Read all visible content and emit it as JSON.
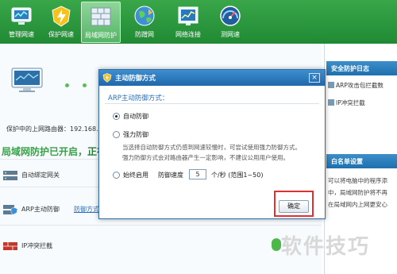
{
  "toolbar": {
    "items": [
      {
        "label": "管理网速",
        "icon": "speed-monitor-icon"
      },
      {
        "label": "保护网速",
        "icon": "lightning-shield-icon"
      },
      {
        "label": "局域网防护",
        "icon": "lan-wall-icon"
      },
      {
        "label": "防蹭网",
        "icon": "globe-icon"
      },
      {
        "label": "网络连接",
        "icon": "network-chart-icon"
      },
      {
        "label": "测网速",
        "icon": "speedometer-icon"
      }
    ],
    "active_index": 2
  },
  "main": {
    "gateway_label": "保护中的上网路由器：192.168.",
    "status_prefix": "局域网防护已开启，",
    "status_rest": "正在",
    "features": [
      {
        "name": "自动绑定网关"
      },
      {
        "name": "ARP主动防御",
        "link": "防御方式"
      },
      {
        "name": "IP冲突拦截"
      }
    ]
  },
  "side": {
    "log_title": "安全防护日志",
    "log_items": [
      "ARP攻击包拦截数",
      "IP冲突拦截"
    ],
    "whitelist_title": "白名单设置",
    "whitelist_lines": [
      "可以将电脑中的程序添",
      "中，局域网防护将不再",
      "在局域网内上网更安心"
    ]
  },
  "dialog": {
    "title": "主动防御方式",
    "close_glyph": "×",
    "section_label": "ARP主动防御方式：",
    "options": {
      "auto": "自动防御",
      "strong": "强力防御",
      "strong_desc_1": "当选择自动防御方式仍感到网速较慢时，可尝试使用强力防御方式。",
      "strong_desc_2": "强力防御方式会对路由器产生一定影响，不建议公用用户使用。",
      "always": "始终启用",
      "speed_label": "防御速度",
      "speed_value": "5",
      "speed_unit": "个/秒 (范围1~50)"
    },
    "selected": "auto",
    "ok_label": "确定"
  },
  "watermark": "软件技巧",
  "colors": {
    "toolbar_green": "#1f8a33",
    "dialog_blue": "#1e67aa",
    "highlight_red": "#e03030",
    "status_green": "#3aa04a"
  }
}
